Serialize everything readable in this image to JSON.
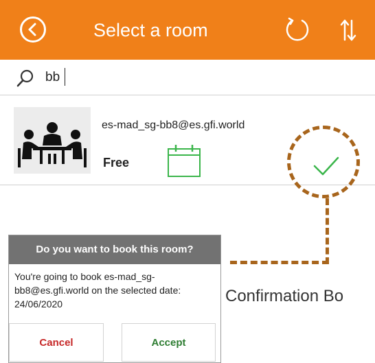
{
  "header": {
    "title": "Select a room",
    "background_color": "#f08019",
    "icons": [
      "back-arrow-circle-icon",
      "refresh-icon",
      "sort-icon"
    ]
  },
  "search": {
    "value": "bb",
    "icon": "search-icon"
  },
  "rooms": [
    {
      "email": "es-mad_sg-bb8@es.gfi.world",
      "status": "Free",
      "icons": [
        "meeting-room-icon",
        "calendar-icon",
        "checkmark-icon"
      ]
    }
  ],
  "annotation": {
    "label": "Confirmation Bo",
    "color": "#a8651c"
  },
  "dialog": {
    "title": "Do you want to book this room?",
    "message": "You're going to book es-mad_sg-bb8@es.gfi.world on the selected date: 24/06/2020",
    "cancel_label": "Cancel",
    "accept_label": "Accept",
    "cancel_color": "#c62828",
    "accept_color": "#2e7d32"
  },
  "colors": {
    "status_free": "#3ab54a"
  }
}
